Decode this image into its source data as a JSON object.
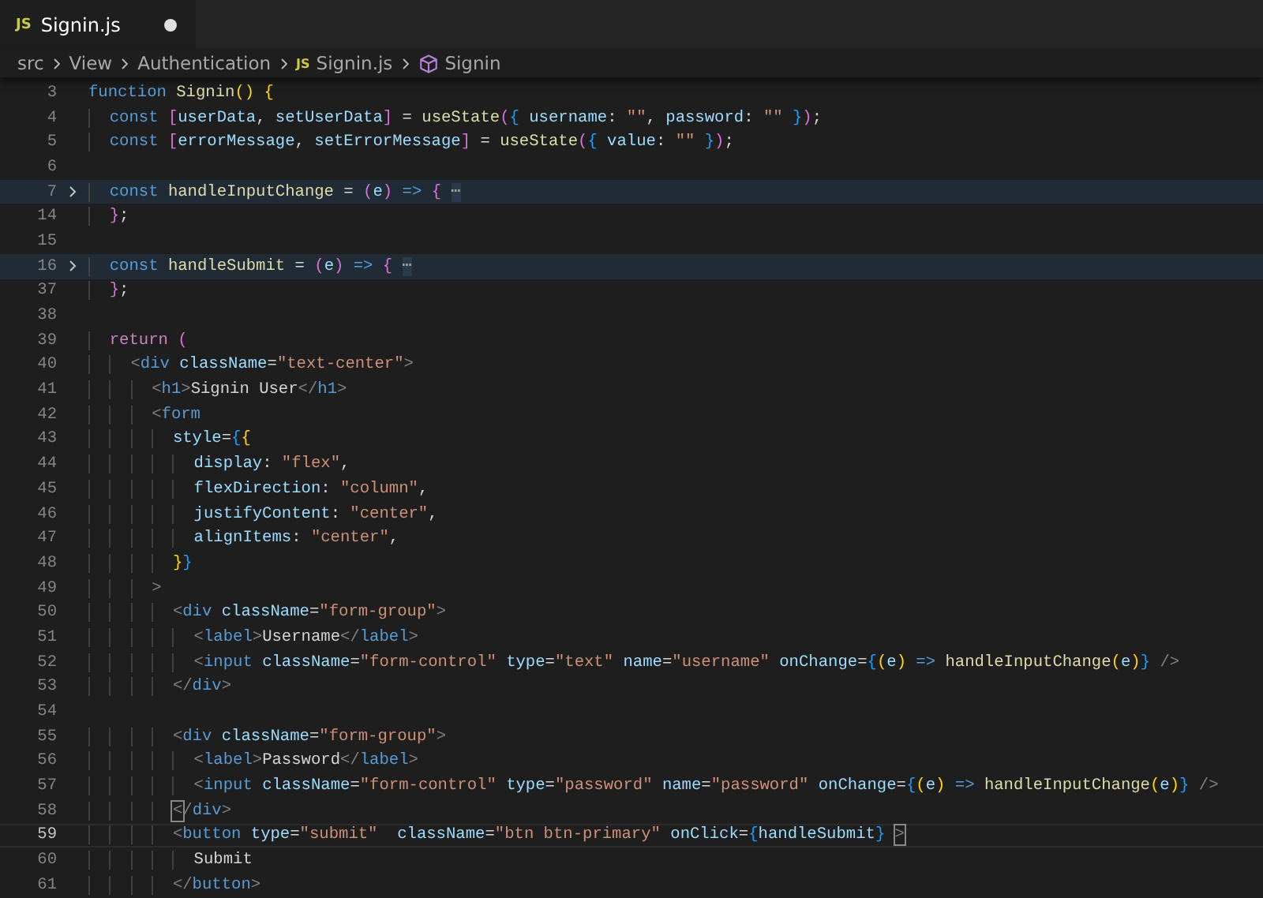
{
  "tabs": [
    {
      "badge": "JS",
      "label": "Signin.js",
      "selected": true,
      "modified": true
    }
  ],
  "breadcrumb": [
    {
      "kind": "folder",
      "label": "src"
    },
    {
      "kind": "folder",
      "label": "View"
    },
    {
      "kind": "folder",
      "label": "Authentication"
    },
    {
      "kind": "file",
      "badge": "JS",
      "label": "Signin.js"
    },
    {
      "kind": "symbol",
      "label": "Signin"
    }
  ],
  "editor": {
    "lines": [
      {
        "number": "3",
        "folded": false,
        "current": false,
        "tokens": [
          {
            "kind": "kw",
            "text": "function "
          },
          {
            "kind": "fn",
            "text": "Signin"
          },
          {
            "kind": "b1",
            "text": "() {"
          }
        ]
      },
      {
        "number": "4",
        "folded": false,
        "current": false,
        "tokens": [
          {
            "kind": "kw",
            "text": "  const "
          },
          {
            "kind": "b2",
            "text": "["
          },
          {
            "kind": "var",
            "text": "userData"
          },
          {
            "kind": "p",
            "text": ", "
          },
          {
            "kind": "var",
            "text": "setUserData"
          },
          {
            "kind": "b2",
            "text": "]"
          },
          {
            "kind": "p",
            "text": " = "
          },
          {
            "kind": "fn",
            "text": "useState"
          },
          {
            "kind": "b2",
            "text": "("
          },
          {
            "kind": "b3",
            "text": "{ "
          },
          {
            "kind": "var",
            "text": "username"
          },
          {
            "kind": "p",
            "text": ": "
          },
          {
            "kind": "str",
            "text": "\"\""
          },
          {
            "kind": "p",
            "text": ", "
          },
          {
            "kind": "var",
            "text": "password"
          },
          {
            "kind": "p",
            "text": ": "
          },
          {
            "kind": "str",
            "text": "\"\" "
          },
          {
            "kind": "b3",
            "text": "}"
          },
          {
            "kind": "b2",
            "text": ")"
          },
          {
            "kind": "p",
            "text": ";"
          }
        ]
      },
      {
        "number": "5",
        "folded": false,
        "current": false,
        "tokens": [
          {
            "kind": "kw",
            "text": "  const "
          },
          {
            "kind": "b2",
            "text": "["
          },
          {
            "kind": "var",
            "text": "errorMessage"
          },
          {
            "kind": "p",
            "text": ", "
          },
          {
            "kind": "var",
            "text": "setErrorMessage"
          },
          {
            "kind": "b2",
            "text": "]"
          },
          {
            "kind": "p",
            "text": " = "
          },
          {
            "kind": "fn",
            "text": "useState"
          },
          {
            "kind": "b2",
            "text": "("
          },
          {
            "kind": "b3",
            "text": "{ "
          },
          {
            "kind": "var",
            "text": "value"
          },
          {
            "kind": "p",
            "text": ": "
          },
          {
            "kind": "str",
            "text": "\"\" "
          },
          {
            "kind": "b3",
            "text": "}"
          },
          {
            "kind": "b2",
            "text": ")"
          },
          {
            "kind": "p",
            "text": ";"
          }
        ]
      },
      {
        "number": "6",
        "folded": false,
        "current": false
      },
      {
        "number": "7",
        "folded": true,
        "current": false,
        "tokens": [
          {
            "kind": "kw",
            "text": "  const "
          },
          {
            "kind": "fn",
            "text": "handleInputChange"
          },
          {
            "kind": "p",
            "text": " = "
          },
          {
            "kind": "b2",
            "text": "("
          },
          {
            "kind": "var",
            "text": "e"
          },
          {
            "kind": "b2",
            "text": ") "
          },
          {
            "kind": "kw",
            "text": "=> "
          },
          {
            "kind": "b2",
            "text": "{"
          },
          {
            "kind": "fold",
            "text": "⋯"
          }
        ]
      },
      {
        "number": "14",
        "folded": false,
        "current": false,
        "tokens": [
          {
            "kind": "b2",
            "text": "  }"
          },
          {
            "kind": "p",
            "text": ";"
          }
        ]
      },
      {
        "number": "15",
        "folded": false,
        "current": false
      },
      {
        "number": "16",
        "folded": true,
        "current": false,
        "tokens": [
          {
            "kind": "kw",
            "text": "  const "
          },
          {
            "kind": "fn",
            "text": "handleSubmit"
          },
          {
            "kind": "p",
            "text": " = "
          },
          {
            "kind": "b2",
            "text": "("
          },
          {
            "kind": "var",
            "text": "e"
          },
          {
            "kind": "b2",
            "text": ") "
          },
          {
            "kind": "kw",
            "text": "=> "
          },
          {
            "kind": "b2",
            "text": "{"
          },
          {
            "kind": "fold",
            "text": "⋯"
          }
        ]
      },
      {
        "number": "37",
        "folded": false,
        "current": false,
        "tokens": [
          {
            "kind": "b2",
            "text": "  }"
          },
          {
            "kind": "p",
            "text": ";"
          }
        ]
      },
      {
        "number": "38",
        "folded": false,
        "current": false
      },
      {
        "number": "39",
        "folded": false,
        "current": false,
        "tokens": [
          {
            "kind": "ctl",
            "text": "  return "
          },
          {
            "kind": "b2",
            "text": "("
          }
        ]
      },
      {
        "number": "40",
        "folded": false,
        "current": false,
        "tokens": [
          {
            "kind": "tag",
            "text": "    <"
          },
          {
            "kind": "tagname",
            "text": "div "
          },
          {
            "kind": "attr",
            "text": "className"
          },
          {
            "kind": "p",
            "text": "="
          },
          {
            "kind": "str",
            "text": "\"text-center\""
          },
          {
            "kind": "tag",
            "text": ">"
          }
        ]
      },
      {
        "number": "41",
        "folded": false,
        "current": false,
        "tokens": [
          {
            "kind": "tag",
            "text": "      <"
          },
          {
            "kind": "tagname",
            "text": "h1"
          },
          {
            "kind": "tag",
            "text": ">"
          },
          {
            "kind": "txt",
            "text": "Signin User"
          },
          {
            "kind": "tag",
            "text": "</"
          },
          {
            "kind": "tagname",
            "text": "h1"
          },
          {
            "kind": "tag",
            "text": ">"
          }
        ]
      },
      {
        "number": "42",
        "folded": false,
        "current": false,
        "tokens": [
          {
            "kind": "tag",
            "text": "      <"
          },
          {
            "kind": "tagname",
            "text": "form"
          }
        ]
      },
      {
        "number": "43",
        "folded": false,
        "current": false,
        "tokens": [
          {
            "kind": "attr",
            "text": "        style"
          },
          {
            "kind": "p",
            "text": "="
          },
          {
            "kind": "b3",
            "text": "{"
          },
          {
            "kind": "b1",
            "text": "{"
          }
        ]
      },
      {
        "number": "44",
        "folded": false,
        "current": false,
        "tokens": [
          {
            "kind": "var",
            "text": "          display"
          },
          {
            "kind": "p",
            "text": ": "
          },
          {
            "kind": "str",
            "text": "\"flex\""
          },
          {
            "kind": "p",
            "text": ","
          }
        ]
      },
      {
        "number": "45",
        "folded": false,
        "current": false,
        "tokens": [
          {
            "kind": "var",
            "text": "          flexDirection"
          },
          {
            "kind": "p",
            "text": ": "
          },
          {
            "kind": "str",
            "text": "\"column\""
          },
          {
            "kind": "p",
            "text": ","
          }
        ]
      },
      {
        "number": "46",
        "folded": false,
        "current": false,
        "tokens": [
          {
            "kind": "var",
            "text": "          justifyContent"
          },
          {
            "kind": "p",
            "text": ": "
          },
          {
            "kind": "str",
            "text": "\"center\""
          },
          {
            "kind": "p",
            "text": ","
          }
        ]
      },
      {
        "number": "47",
        "folded": false,
        "current": false,
        "tokens": [
          {
            "kind": "var",
            "text": "          alignItems"
          },
          {
            "kind": "p",
            "text": ": "
          },
          {
            "kind": "str",
            "text": "\"center\""
          },
          {
            "kind": "p",
            "text": ","
          }
        ]
      },
      {
        "number": "48",
        "folded": false,
        "current": false,
        "tokens": [
          {
            "kind": "b1",
            "text": "        }"
          },
          {
            "kind": "b3",
            "text": "}"
          }
        ]
      },
      {
        "number": "49",
        "folded": false,
        "current": false,
        "tokens": [
          {
            "kind": "tag",
            "text": "      >"
          }
        ]
      },
      {
        "number": "50",
        "folded": false,
        "current": false,
        "tokens": [
          {
            "kind": "tag",
            "text": "        <"
          },
          {
            "kind": "tagname",
            "text": "div "
          },
          {
            "kind": "attr",
            "text": "className"
          },
          {
            "kind": "p",
            "text": "="
          },
          {
            "kind": "str",
            "text": "\"form-group\""
          },
          {
            "kind": "tag",
            "text": ">"
          }
        ]
      },
      {
        "number": "51",
        "folded": false,
        "current": false,
        "tokens": [
          {
            "kind": "tag",
            "text": "          <"
          },
          {
            "kind": "tagname",
            "text": "label"
          },
          {
            "kind": "tag",
            "text": ">"
          },
          {
            "kind": "txt",
            "text": "Username"
          },
          {
            "kind": "tag",
            "text": "</"
          },
          {
            "kind": "tagname",
            "text": "label"
          },
          {
            "kind": "tag",
            "text": ">"
          }
        ]
      },
      {
        "number": "52",
        "folded": false,
        "current": false,
        "tokens": [
          {
            "kind": "tag",
            "text": "          <"
          },
          {
            "kind": "tagname",
            "text": "input "
          },
          {
            "kind": "attr",
            "text": "className"
          },
          {
            "kind": "p",
            "text": "="
          },
          {
            "kind": "str",
            "text": "\"form-control\" "
          },
          {
            "kind": "attr",
            "text": "type"
          },
          {
            "kind": "p",
            "text": "="
          },
          {
            "kind": "str",
            "text": "\"text\" "
          },
          {
            "kind": "attr",
            "text": "name"
          },
          {
            "kind": "p",
            "text": "="
          },
          {
            "kind": "str",
            "text": "\"username\" "
          },
          {
            "kind": "attr",
            "text": "onChange"
          },
          {
            "kind": "p",
            "text": "="
          },
          {
            "kind": "b3",
            "text": "{"
          },
          {
            "kind": "b1",
            "text": "("
          },
          {
            "kind": "var",
            "text": "e"
          },
          {
            "kind": "b1",
            "text": ") "
          },
          {
            "kind": "kw",
            "text": "=> "
          },
          {
            "kind": "fn",
            "text": "handleInputChange"
          },
          {
            "kind": "b1",
            "text": "("
          },
          {
            "kind": "var",
            "text": "e"
          },
          {
            "kind": "b1",
            "text": ")"
          },
          {
            "kind": "b3",
            "text": "} "
          },
          {
            "kind": "tag",
            "text": "/>"
          }
        ]
      },
      {
        "number": "53",
        "folded": false,
        "current": false,
        "tokens": [
          {
            "kind": "tag",
            "text": "        </"
          },
          {
            "kind": "tagname",
            "text": "div"
          },
          {
            "kind": "tag",
            "text": ">"
          }
        ]
      },
      {
        "number": "54",
        "folded": false,
        "current": false
      },
      {
        "number": "55",
        "folded": false,
        "current": false,
        "tokens": [
          {
            "kind": "tag",
            "text": "        <"
          },
          {
            "kind": "tagname",
            "text": "div "
          },
          {
            "kind": "attr",
            "text": "className"
          },
          {
            "kind": "p",
            "text": "="
          },
          {
            "kind": "str",
            "text": "\"form-group\""
          },
          {
            "kind": "tag",
            "text": ">"
          }
        ]
      },
      {
        "number": "56",
        "folded": false,
        "current": false,
        "tokens": [
          {
            "kind": "tag",
            "text": "          <"
          },
          {
            "kind": "tagname",
            "text": "label"
          },
          {
            "kind": "tag",
            "text": ">"
          },
          {
            "kind": "txt",
            "text": "Password"
          },
          {
            "kind": "tag",
            "text": "</"
          },
          {
            "kind": "tagname",
            "text": "label"
          },
          {
            "kind": "tag",
            "text": ">"
          }
        ]
      },
      {
        "number": "57",
        "folded": false,
        "current": false,
        "tokens": [
          {
            "kind": "tag",
            "text": "          <"
          },
          {
            "kind": "tagname",
            "text": "input "
          },
          {
            "kind": "attr",
            "text": "className"
          },
          {
            "kind": "p",
            "text": "="
          },
          {
            "kind": "str",
            "text": "\"form-control\" "
          },
          {
            "kind": "attr",
            "text": "type"
          },
          {
            "kind": "p",
            "text": "="
          },
          {
            "kind": "str",
            "text": "\"password\" "
          },
          {
            "kind": "attr",
            "text": "name"
          },
          {
            "kind": "p",
            "text": "="
          },
          {
            "kind": "str",
            "text": "\"password\" "
          },
          {
            "kind": "attr",
            "text": "onChange"
          },
          {
            "kind": "p",
            "text": "="
          },
          {
            "kind": "b3",
            "text": "{"
          },
          {
            "kind": "b1",
            "text": "("
          },
          {
            "kind": "var",
            "text": "e"
          },
          {
            "kind": "b1",
            "text": ") "
          },
          {
            "kind": "kw",
            "text": "=> "
          },
          {
            "kind": "fn",
            "text": "handleInputChange"
          },
          {
            "kind": "b1",
            "text": "("
          },
          {
            "kind": "var",
            "text": "e"
          },
          {
            "kind": "b1",
            "text": ")"
          },
          {
            "kind": "b3",
            "text": "} "
          },
          {
            "kind": "tag",
            "text": "/>"
          }
        ]
      },
      {
        "number": "58",
        "folded": false,
        "current": false,
        "tokens": [
          {
            "kind": "match",
            "text": "        <"
          },
          {
            "kind": "tag",
            "text": "/"
          },
          {
            "kind": "tagname",
            "text": "div"
          },
          {
            "kind": "tag",
            "text": ">"
          }
        ]
      },
      {
        "number": "59",
        "folded": false,
        "current": true,
        "tokens": [
          {
            "kind": "tag",
            "text": "        <"
          },
          {
            "kind": "tagname",
            "text": "button "
          },
          {
            "kind": "attr",
            "text": "type"
          },
          {
            "kind": "p",
            "text": "="
          },
          {
            "kind": "str",
            "text": "\"submit\"  "
          },
          {
            "kind": "attr",
            "text": "className"
          },
          {
            "kind": "p",
            "text": "="
          },
          {
            "kind": "str",
            "text": "\"btn btn-primary\" "
          },
          {
            "kind": "attr",
            "text": "onClick"
          },
          {
            "kind": "p",
            "text": "="
          },
          {
            "kind": "b3",
            "text": "{"
          },
          {
            "kind": "var",
            "text": "handleSubmit"
          },
          {
            "kind": "b3",
            "text": "} "
          },
          {
            "kind": "match",
            "text": ">"
          }
        ]
      },
      {
        "number": "60",
        "folded": false,
        "current": false,
        "tokens": [
          {
            "kind": "txt",
            "text": "          Submit"
          }
        ]
      },
      {
        "number": "61",
        "folded": false,
        "current": false,
        "tokens": [
          {
            "kind": "tag",
            "text": "        </"
          },
          {
            "kind": "tagname",
            "text": "button"
          },
          {
            "kind": "tag",
            "text": ">"
          }
        ]
      }
    ]
  }
}
